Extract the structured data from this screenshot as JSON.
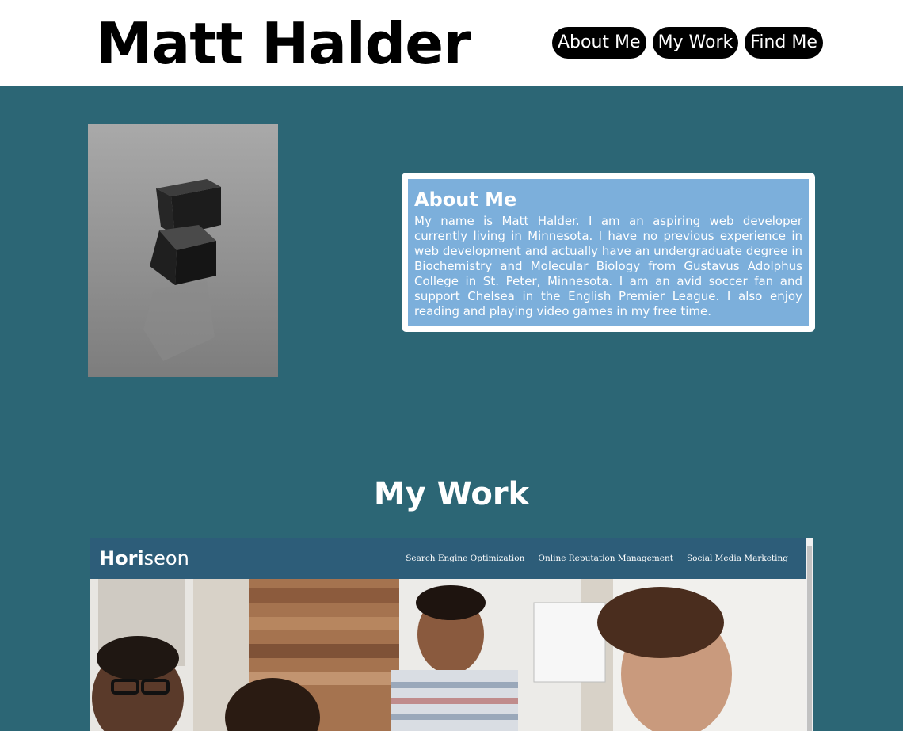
{
  "header": {
    "title": "Matt Halder",
    "nav": [
      "About Me",
      "My Work",
      "Find Me"
    ]
  },
  "about": {
    "title": "About Me",
    "text": "My name is Matt Halder. I am an aspiring web developer currently living in Minnesota. I have no previous experience in web development and actually have an undergraduate degree in Biochemistry and Molecular Biology from Gustavus Adolphus College in St. Peter, Minnesota. I am an avid soccer fan and support Chelsea in the English Premier League. I also enjoy reading and playing video games in my free time."
  },
  "work": {
    "title": "My Work",
    "project": {
      "logo_prefix": "Hori",
      "logo_suffix": "seon",
      "nav": [
        "Search Engine Optimization",
        "Online Reputation Management",
        "Social Media Marketing"
      ]
    }
  },
  "colors": {
    "page_background": "#2c6675",
    "about_card_fill": "#7cafdb",
    "nav_button": "#000000",
    "project_header": "#2d5d79"
  }
}
